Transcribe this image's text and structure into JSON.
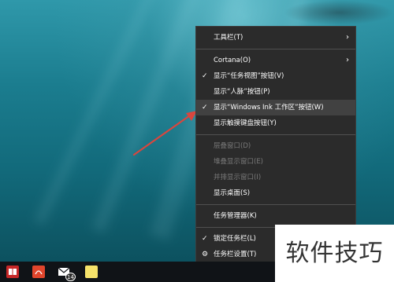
{
  "context_menu": {
    "items": [
      {
        "label": "工具栏(T)",
        "checked": false,
        "disabled": false,
        "submenu": true
      },
      {
        "separator": true
      },
      {
        "label": "Cortana(O)",
        "checked": false,
        "disabled": false,
        "submenu": true
      },
      {
        "label": "显示“任务视图”按钮(V)",
        "checked": true,
        "disabled": false
      },
      {
        "label": "显示“人脉”按钮(P)",
        "checked": false,
        "disabled": false
      },
      {
        "label": "显示“Windows Ink 工作区”按钮(W)",
        "checked": true,
        "disabled": false,
        "highlighted": true
      },
      {
        "label": "显示触摸键盘按钮(Y)",
        "checked": false,
        "disabled": false
      },
      {
        "separator": true
      },
      {
        "label": "层叠窗口(D)",
        "checked": false,
        "disabled": true
      },
      {
        "label": "堆叠显示窗口(E)",
        "checked": false,
        "disabled": true
      },
      {
        "label": "并排显示窗口(I)",
        "checked": false,
        "disabled": true
      },
      {
        "label": "显示桌面(S)",
        "checked": false,
        "disabled": false
      },
      {
        "separator": true
      },
      {
        "label": "任务管理器(K)",
        "checked": false,
        "disabled": false
      },
      {
        "separator": true
      },
      {
        "label": "锁定任务栏(L)",
        "checked": true,
        "disabled": false
      },
      {
        "label": "任务栏设置(T)",
        "checked": false,
        "disabled": false,
        "icon": "gear-icon"
      }
    ]
  },
  "taskbar": {
    "mail_badge": "14",
    "icons": [
      "book-app-icon",
      "pdf-app-icon",
      "mail-icon",
      "sticky-notes-icon"
    ]
  },
  "watermark": "软件技巧",
  "colors": {
    "menu_bg": "#2b2b2b",
    "menu_highlight": "#414141",
    "arrow": "#d9463e",
    "taskbar_bg": "#101317"
  }
}
